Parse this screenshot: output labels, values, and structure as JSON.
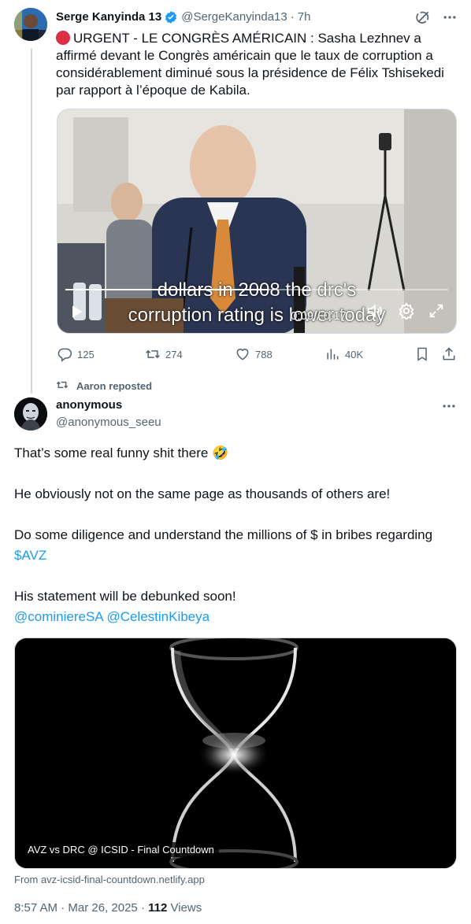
{
  "parent_tweet": {
    "display_name": "Serge Kanyinda 13",
    "handle": "@SergeKanyinda13",
    "separator": "·",
    "time": "7h",
    "text": "URGENT - LE CONGRÈS AMÉRICAIN : Sasha Lezhnev a affirmé devant le Congrès américain que le taux de corruption a considérablement diminué sous la présidence de Félix Tshisekedi par rapport à l’époque de Kabila.",
    "video": {
      "caption_line_1": "dollars in 2008 the drc's",
      "caption_line_2": "corruption rating is lower today",
      "elapsed": "0:09",
      "duration": "0:17",
      "time_display": "0:09 / 0:17",
      "progress_fraction": 0.53
    },
    "stats": {
      "replies": "125",
      "reposts": "274",
      "likes": "788",
      "views": "40K"
    }
  },
  "repost_banner": {
    "label": "Aaron reposted"
  },
  "main_tweet": {
    "display_name": "anonymous",
    "handle": "@anonymous_seeu",
    "paragraph_1": "That’s some real funny shit there",
    "paragraph_1_emoji": "🤣",
    "paragraph_2": "He obviously not on the same page as thousands of others are!",
    "paragraph_3_prefix": "Do some diligence and understand the millions of $ in bribes regarding",
    "cashtag": "$AVZ",
    "paragraph_4": "His statement will be debunked soon!",
    "mention_1": "@cominiereSA",
    "mention_2": "@CelestinKibeya",
    "card": {
      "title": "AVZ vs DRC @ ICSID - Final Countdown",
      "source": "From avz-icsid-final-countdown.netlify.app"
    },
    "timestamp": "8:57 AM · Mar 26, 2025",
    "views_separator": "·",
    "views_count": "112",
    "views_label": "Views"
  },
  "colors": {
    "text": "#0f1419",
    "secondary": "#536471",
    "link": "#1d9bf0",
    "verified": "#1d9bf0",
    "border": "#cfd9de",
    "urgent_dot": "#dd2e44"
  },
  "icons": [
    "verified-badge-icon",
    "grok-icon",
    "more-icon",
    "play-icon",
    "volume-icon",
    "settings-icon",
    "fullscreen-icon",
    "reply-icon",
    "repost-icon",
    "like-icon",
    "views-icon",
    "bookmark-icon",
    "share-icon"
  ]
}
